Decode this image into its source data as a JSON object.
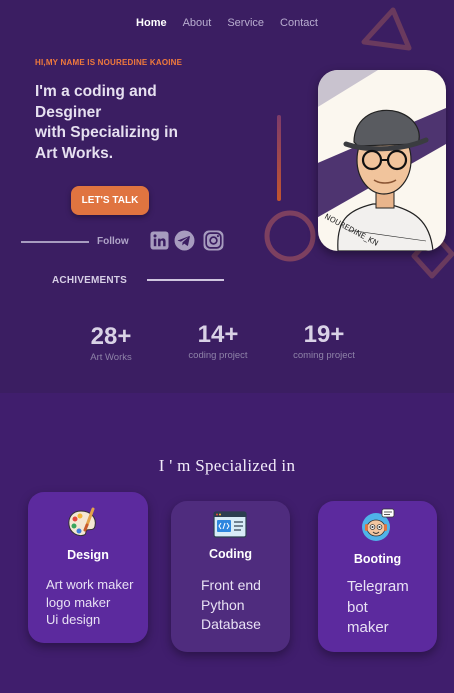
{
  "nav": {
    "items": [
      {
        "label": "Home",
        "active": true
      },
      {
        "label": "About",
        "active": false
      },
      {
        "label": "Service",
        "active": false
      },
      {
        "label": "Contact",
        "active": false
      }
    ]
  },
  "hero": {
    "greeting": "HI,MY NAME IS NOUREDINE KAOINE",
    "headline_lines": [
      "I'm a coding and",
      "Desginer",
      "with Specializing  in",
      "Art Works."
    ],
    "cta_label": "LET'S TALK",
    "follow_label": "Follow",
    "social_icons": [
      "linkedin-icon",
      "telegram-icon",
      "instagram-icon"
    ],
    "portrait_caption": "NOUREDINE_KN"
  },
  "achievements": {
    "label": "ACHIVEMENTS",
    "stats": [
      {
        "value": "28+",
        "label": "Art Works"
      },
      {
        "value": "14+",
        "label": "coding project"
      },
      {
        "value": "19+",
        "label": "coming project"
      }
    ]
  },
  "specialized": {
    "title": "I ' m Specialized in",
    "cards": [
      {
        "title": "Design",
        "icon": "palette-icon",
        "lines": [
          "Art work maker",
          "logo maker",
          "Ui  design"
        ]
      },
      {
        "title": "Coding",
        "icon": "code-window-icon",
        "lines": [
          "Front end",
          "Python",
          "Database"
        ]
      },
      {
        "title": "Booting",
        "icon": "robot-icon",
        "lines": [
          "Telegram",
          "bot",
          "maker"
        ]
      }
    ]
  },
  "colors": {
    "hero_bg": "#3b1e62",
    "accent_orange": "#e07440",
    "card_purple": "#5c2a9e",
    "card_grey_purple": "#4f2c7e"
  }
}
